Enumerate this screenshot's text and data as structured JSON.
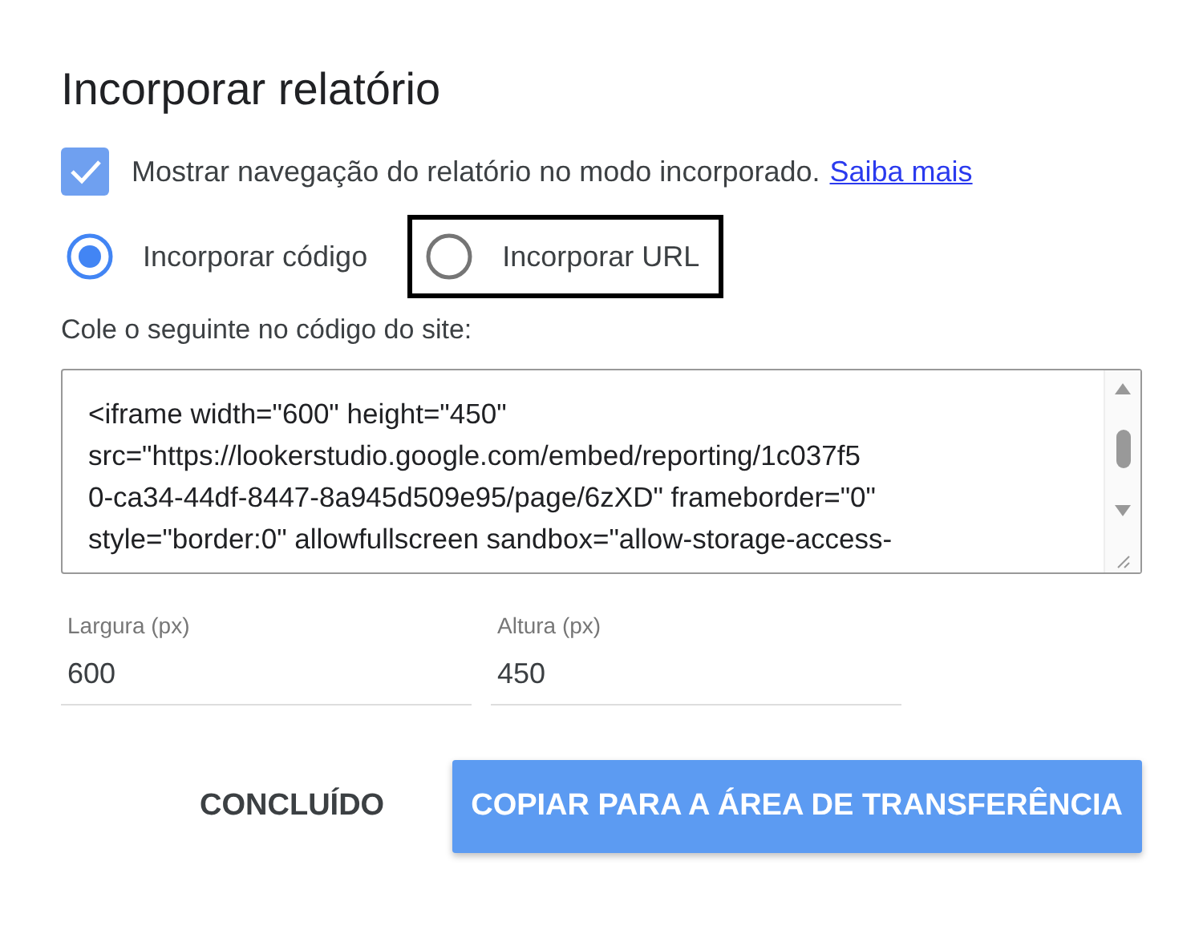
{
  "dialog": {
    "title": "Incorporar relatório",
    "navigation_checkbox": {
      "label": "Mostrar navegação do relatório no modo incorporado.",
      "link": "Saiba mais",
      "checked": true
    },
    "embed_options": [
      {
        "label": "Incorporar código",
        "selected": true,
        "focused": false
      },
      {
        "label": "Incorporar URL",
        "selected": false,
        "focused": true
      }
    ],
    "code_label": "Cole o seguinte no código do site:",
    "code_lines": [
      "<iframe width=\"600\" height=\"450\"",
      "src=\"https://lookerstudio.google.com/embed/reporting/1c037f5",
      "0-ca34-44df-8447-8a945d509e95/page/6zXD\" frameborder=\"0\"",
      "style=\"border:0\" allowfullscreen sandbox=\"allow-storage-access-"
    ],
    "fields": [
      {
        "label": "Largura (px)",
        "value": "600"
      },
      {
        "label": "Altura (px)",
        "value": "450"
      }
    ],
    "buttons": [
      {
        "label": "CONCLUÍDO",
        "kind": "text"
      },
      {
        "label": "COPIAR PARA A ÁREA DE TRANSFERÊNCIA",
        "kind": "raised"
      }
    ]
  }
}
